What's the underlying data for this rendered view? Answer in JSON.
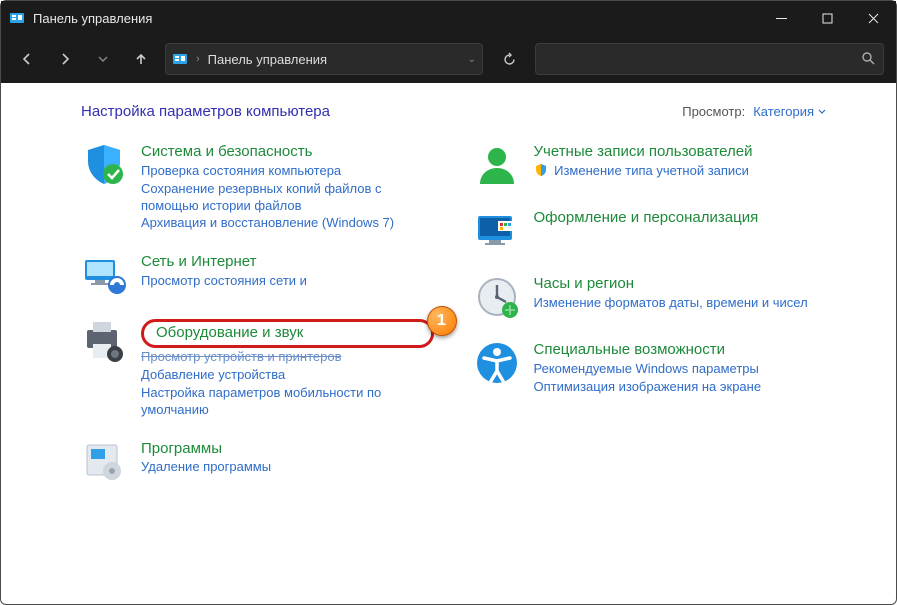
{
  "window": {
    "title": "Панель управления"
  },
  "address": {
    "location": "Панель управления"
  },
  "search": {
    "placeholder": ""
  },
  "page": {
    "heading": "Настройка параметров компьютера",
    "view_label": "Просмотр:",
    "view_value": "Категория"
  },
  "left": [
    {
      "name": "Система и безопасность",
      "links": [
        "Проверка состояния компьютера",
        "Сохранение резервных копий файлов с помощью истории файлов",
        "Архивация и восстановление (Windows 7)"
      ]
    },
    {
      "name": "Сеть и Интернет",
      "links": [
        "Просмотр состояния сети и"
      ]
    },
    {
      "name": "Оборудование и звук",
      "links": [
        "Просмотр устройств и принтеров",
        "Добавление устройства",
        "Настройка параметров мобильности по умолчанию"
      ],
      "highlight": true
    },
    {
      "name": "Программы",
      "links": [
        "Удаление программы"
      ]
    }
  ],
  "right": [
    {
      "name": "Учетные записи пользователей",
      "links": [
        "Изменение типа учетной записи"
      ],
      "linkShield": [
        true
      ]
    },
    {
      "name": "Оформление и персонализация",
      "links": []
    },
    {
      "name": "Часы и регион",
      "links": [
        "Изменение форматов даты, времени и чисел"
      ]
    },
    {
      "name": "Специальные возможности",
      "links": [
        "Рекомендуемые Windows параметры",
        "Оптимизация изображения на экране"
      ]
    }
  ],
  "annotation": {
    "number": "1"
  }
}
